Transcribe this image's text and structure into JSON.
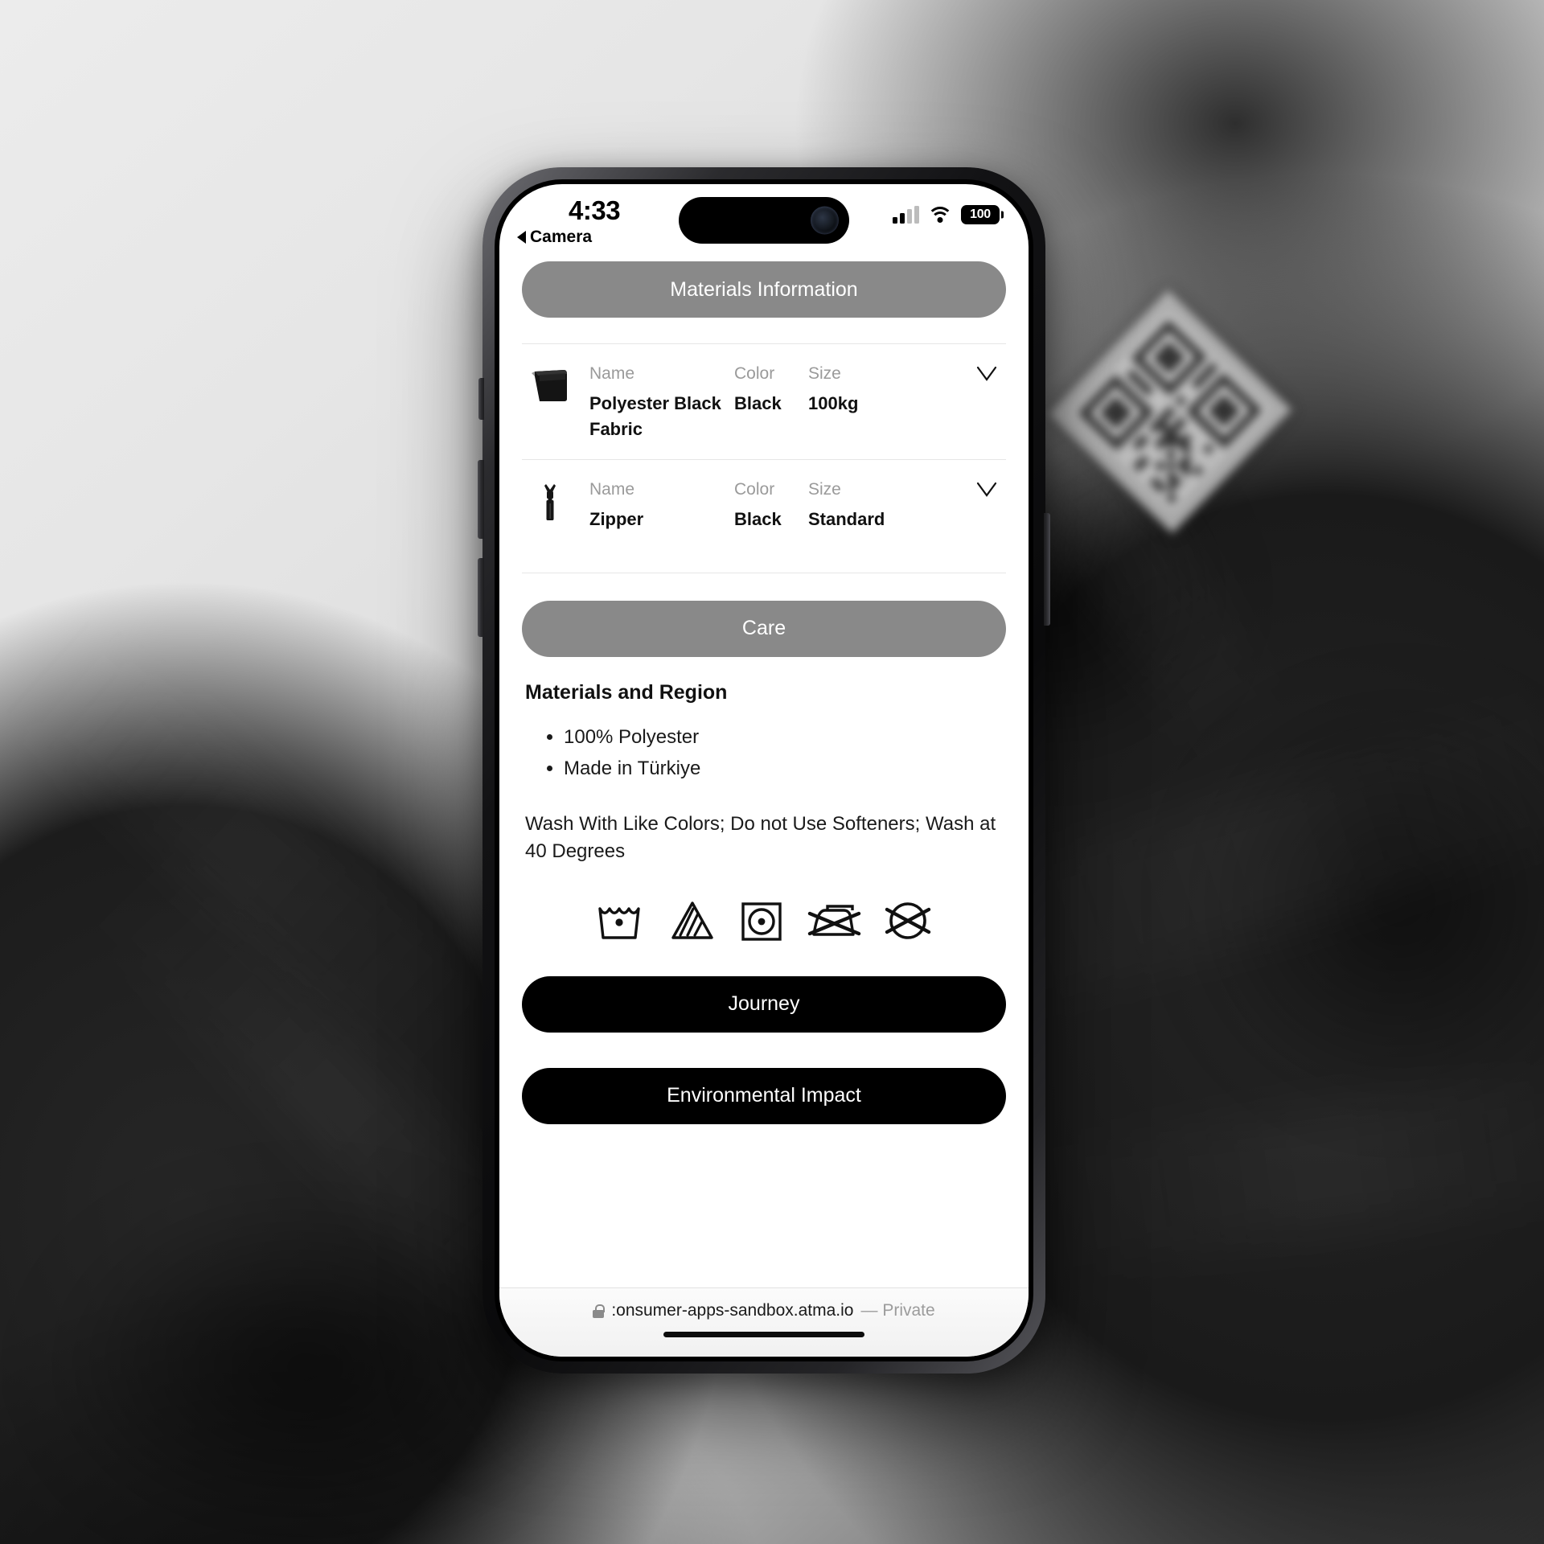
{
  "status_bar": {
    "time": "4:33",
    "back_label": "Camera",
    "back_icon": "triangle-left-icon",
    "signal_icon": "cellular-signal-icon",
    "wifi_icon": "wifi-icon",
    "battery_percent": "100",
    "battery_icon": "battery-full-icon"
  },
  "page": {
    "materials_information_label": "Materials Information",
    "care_label": "Care",
    "materials_region_heading": "Materials and Region",
    "materials": [
      {
        "thumb_icon": "fabric-roll-icon",
        "name_label": "Name",
        "name_value": "Polyester Black Fabric",
        "color_label": "Color",
        "color_value": "Black",
        "size_label": "Size",
        "size_value": "100kg",
        "expand_icon": "chevron-down-icon"
      },
      {
        "thumb_icon": "zipper-icon",
        "name_label": "Name",
        "name_value": "Zipper",
        "color_label": "Color",
        "color_value": "Black",
        "size_label": "Size",
        "size_value": "Standard",
        "expand_icon": "chevron-down-icon"
      }
    ],
    "region_bullets": [
      "100% Polyester",
      "Made in Türkiye"
    ],
    "wash_instructions": "Wash With Like Colors; Do not Use Softeners; Wash at 40 Degrees",
    "care_symbols": [
      "machine-wash-gentle-icon",
      "non-chlorine-bleach-icon",
      "tumble-dry-low-icon",
      "do-not-iron-icon",
      "do-not-dry-clean-icon"
    ],
    "journey_label": "Journey",
    "environmental_impact_label": "Environmental Impact"
  },
  "browser_bar": {
    "lock_icon": "lock-icon",
    "url": ":onsumer-apps-sandbox.atma.io",
    "privacy_label": "— Private"
  },
  "colors": {
    "gray_button": "#898989",
    "black_button": "#000000",
    "label_gray": "#9a9a9a",
    "text_black": "#111111",
    "page_background": "#ffffff"
  }
}
